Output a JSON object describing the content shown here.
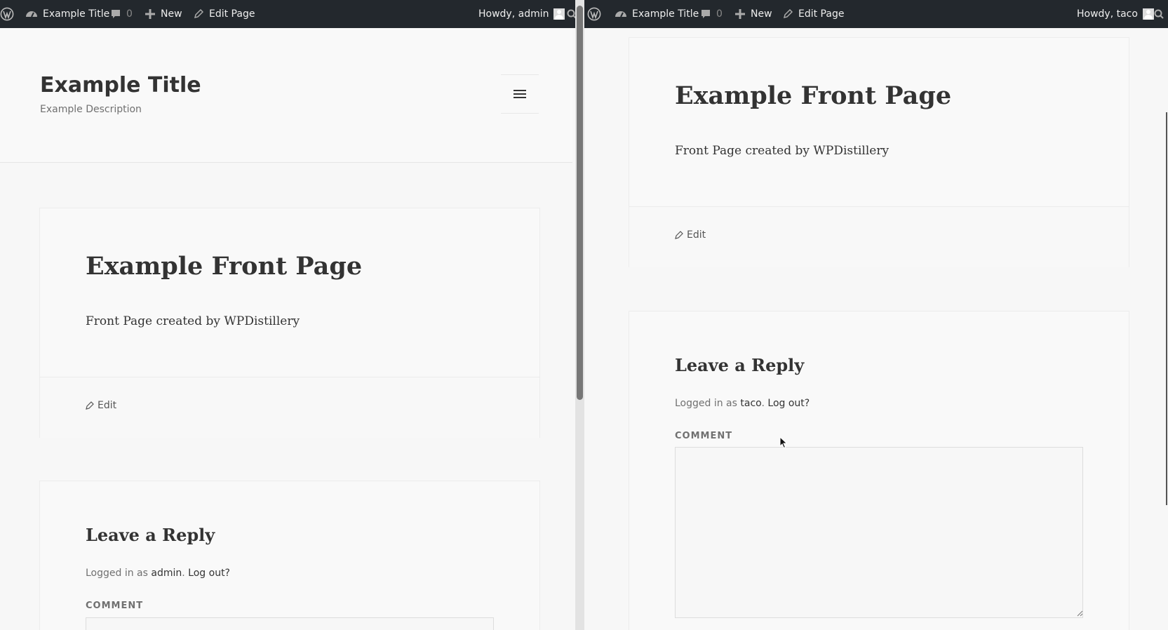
{
  "left": {
    "adminbar": {
      "site_name": "Example Title",
      "comments_count": "0",
      "new_label": "New",
      "edit_label": "Edit Page",
      "howdy": "Howdy, admin"
    },
    "header": {
      "site_title": "Example Title",
      "site_description": "Example Description"
    },
    "page": {
      "title": "Example Front Page",
      "content": "Front Page created by WPDistillery",
      "edit_link": "Edit"
    },
    "reply": {
      "title": "Leave a Reply",
      "logged_in_prefix": "Logged in as",
      "user": "admin",
      "sep": ".",
      "logout": "Log out?",
      "comment_label": "COMMENT"
    }
  },
  "right": {
    "adminbar": {
      "site_name": "Example Title",
      "comments_count": "0",
      "new_label": "New",
      "edit_label": "Edit Page",
      "howdy": "Howdy, taco"
    },
    "page": {
      "title": "Example Front Page",
      "content": "Front Page created by WPDistillery",
      "edit_link": "Edit"
    },
    "reply": {
      "title": "Leave a Reply",
      "logged_in_prefix": "Logged in as",
      "user": "taco",
      "sep": ".",
      "logout": "Log out?",
      "comment_label": "COMMENT"
    }
  },
  "colors": {
    "adminbar_bg": "#23282d",
    "page_bg": "#f7f7f7",
    "card_bg": "#f9f9f9",
    "text": "#333333",
    "muted_text": "#707070"
  },
  "icons": [
    "wordpress-logo-icon",
    "dashboard-icon",
    "comment-bubble-icon",
    "plus-icon",
    "pencil-icon",
    "user-avatar-icon",
    "search-icon",
    "menu-icon",
    "mouse-cursor-icon"
  ]
}
